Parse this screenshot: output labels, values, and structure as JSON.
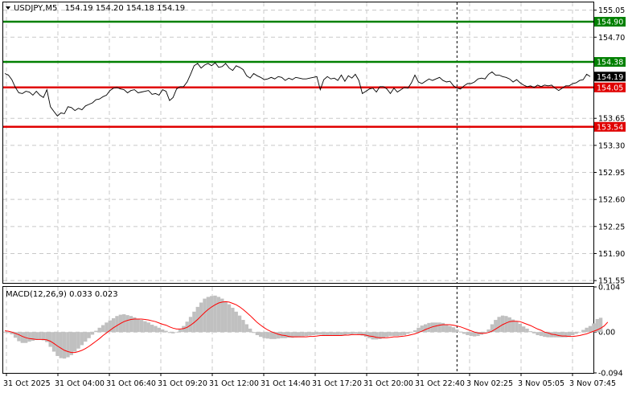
{
  "header": {
    "symbol": "USDJPY,M5",
    "ohlc": "154.19 154.20 154.18 154.19"
  },
  "macd_header": "MACD(12,26,9) 0.033 0.023",
  "colors": {
    "support": "#e00000",
    "resistance": "#008000",
    "price_line": "#000000",
    "histogram": "#c0c0c0",
    "signal": "#ff0000",
    "grid": "#c8c8c8"
  },
  "chart_data": [
    {
      "type": "line",
      "name": "USDJPY,M5",
      "grid": true,
      "ylim": [
        151.52,
        155.15
      ],
      "y_ticks": [
        "155.05",
        "154.70",
        "154.05",
        "153.65",
        "153.30",
        "152.95",
        "152.60",
        "152.25",
        "151.90",
        "151.55"
      ],
      "x_ticks": [
        "31 Oct 2025",
        "31 Oct 04:00",
        "31 Oct 06:40",
        "31 Oct 09:20",
        "31 Oct 12:00",
        "31 Oct 14:40",
        "31 Oct 17:20",
        "31 Oct 20:00",
        "31 Oct 22:40",
        "3 Nov 02:25",
        "3 Nov 05:05",
        "3 Nov 07:45"
      ],
      "levels": [
        {
          "value": 154.9,
          "label": "154.90",
          "kind": "resistance"
        },
        {
          "value": 154.38,
          "label": "154.38",
          "kind": "resistance"
        },
        {
          "value": 154.05,
          "label": "154.05",
          "kind": "support"
        },
        {
          "value": 153.54,
          "label": "153.54",
          "kind": "support"
        }
      ],
      "current": {
        "value": 154.19,
        "label": "154.19"
      },
      "vline_index": 129,
      "values": [
        154.23,
        154.21,
        154.15,
        154.05,
        153.98,
        153.97,
        154.0,
        153.99,
        153.95,
        154.0,
        153.95,
        153.92,
        154.02,
        153.8,
        153.74,
        153.68,
        153.72,
        153.71,
        153.8,
        153.79,
        153.75,
        153.78,
        153.76,
        153.81,
        153.83,
        153.85,
        153.89,
        153.9,
        153.93,
        153.95,
        154.01,
        154.04,
        154.05,
        154.03,
        154.02,
        153.98,
        154.01,
        154.02,
        153.98,
        153.99,
        154.0,
        154.01,
        153.96,
        153.97,
        153.95,
        154.02,
        154.0,
        153.88,
        153.92,
        154.03,
        154.06,
        154.06,
        154.12,
        154.22,
        154.33,
        154.36,
        154.3,
        154.34,
        154.36,
        154.33,
        154.37,
        154.31,
        154.32,
        154.36,
        154.3,
        154.27,
        154.33,
        154.31,
        154.28,
        154.2,
        154.17,
        154.23,
        154.2,
        154.18,
        154.15,
        154.16,
        154.18,
        154.16,
        154.19,
        154.18,
        154.14,
        154.17,
        154.15,
        154.18,
        154.17,
        154.16,
        154.16,
        154.17,
        154.18,
        154.19,
        154.02,
        154.15,
        154.19,
        154.16,
        154.17,
        154.14,
        154.21,
        154.13,
        154.2,
        154.17,
        154.22,
        154.14,
        153.97,
        154.0,
        154.03,
        154.04,
        153.99,
        154.06,
        154.06,
        154.03,
        153.97,
        154.04,
        153.99,
        154.02,
        154.05,
        154.04,
        154.11,
        154.21,
        154.12,
        154.1,
        154.13,
        154.16,
        154.14,
        154.16,
        154.18,
        154.14,
        154.12,
        154.13,
        154.07,
        154.04,
        154.03,
        154.07,
        154.1,
        154.1,
        154.12,
        154.16,
        154.17,
        154.16,
        154.22,
        154.25,
        154.21,
        154.21,
        154.19,
        154.18,
        154.16,
        154.12,
        154.15,
        154.11,
        154.08,
        154.06,
        154.07,
        154.05,
        154.08,
        154.06,
        154.08,
        154.07,
        154.08,
        154.04,
        154.01,
        154.04,
        154.07,
        154.07,
        154.1,
        154.11,
        154.14,
        154.15,
        154.22,
        154.19
      ]
    },
    {
      "type": "bar",
      "name": "MACD(12,26,9)",
      "ylim": [
        -0.094,
        0.104
      ],
      "y_ticks": [
        "0.104",
        "0.00",
        "-0.094"
      ],
      "macd_main": [
        0.0,
        -0.002,
        -0.005,
        -0.013,
        -0.021,
        -0.025,
        -0.025,
        -0.022,
        -0.02,
        -0.018,
        -0.017,
        -0.019,
        -0.023,
        -0.034,
        -0.045,
        -0.055,
        -0.06,
        -0.061,
        -0.058,
        -0.053,
        -0.045,
        -0.038,
        -0.03,
        -0.022,
        -0.014,
        -0.006,
        0.003,
        0.01,
        0.016,
        0.022,
        0.027,
        0.032,
        0.037,
        0.04,
        0.041,
        0.039,
        0.037,
        0.034,
        0.031,
        0.028,
        0.025,
        0.022,
        0.017,
        0.014,
        0.01,
        0.006,
        0.003,
        -0.002,
        -0.003,
        0.0,
        0.006,
        0.014,
        0.024,
        0.035,
        0.047,
        0.058,
        0.068,
        0.077,
        0.081,
        0.083,
        0.084,
        0.081,
        0.077,
        0.071,
        0.064,
        0.056,
        0.047,
        0.038,
        0.028,
        0.018,
        0.008,
        -0.002,
        -0.007,
        -0.011,
        -0.014,
        -0.015,
        -0.016,
        -0.016,
        -0.015,
        -0.014,
        -0.014,
        -0.013,
        -0.013,
        -0.012,
        -0.011,
        -0.01,
        -0.009,
        -0.008,
        -0.007,
        -0.006,
        -0.006,
        -0.008,
        -0.008,
        -0.008,
        -0.008,
        -0.008,
        -0.007,
        -0.007,
        -0.005,
        -0.005,
        -0.004,
        -0.005,
        -0.008,
        -0.011,
        -0.014,
        -0.017,
        -0.017,
        -0.016,
        -0.014,
        -0.011,
        -0.009,
        -0.009,
        -0.009,
        -0.008,
        -0.007,
        -0.004,
        0.0,
        0.004,
        0.01,
        0.015,
        0.018,
        0.021,
        0.022,
        0.022,
        0.022,
        0.021,
        0.018,
        0.014,
        0.011,
        0.006,
        0.001,
        -0.004,
        -0.007,
        -0.009,
        -0.01,
        -0.009,
        -0.006,
        -0.002,
        0.006,
        0.018,
        0.028,
        0.035,
        0.038,
        0.037,
        0.034,
        0.029,
        0.025,
        0.019,
        0.013,
        0.008,
        0.002,
        -0.003,
        -0.007,
        -0.009,
        -0.011,
        -0.012,
        -0.012,
        -0.012,
        -0.012,
        -0.012,
        -0.012,
        -0.01,
        -0.007,
        -0.004,
        0.0,
        0.005,
        0.01,
        0.014,
        0.02,
        0.03,
        0.033
      ],
      "signal": [
        0.003,
        0.002,
        0.0,
        -0.003,
        -0.006,
        -0.01,
        -0.013,
        -0.015,
        -0.016,
        -0.017,
        -0.017,
        -0.017,
        -0.018,
        -0.021,
        -0.026,
        -0.032,
        -0.037,
        -0.042,
        -0.045,
        -0.047,
        -0.047,
        -0.045,
        -0.042,
        -0.038,
        -0.033,
        -0.027,
        -0.021,
        -0.015,
        -0.008,
        -0.002,
        0.004,
        0.01,
        0.015,
        0.02,
        0.024,
        0.027,
        0.029,
        0.03,
        0.03,
        0.03,
        0.029,
        0.028,
        0.026,
        0.024,
        0.021,
        0.018,
        0.016,
        0.012,
        0.009,
        0.007,
        0.007,
        0.008,
        0.011,
        0.016,
        0.022,
        0.029,
        0.037,
        0.045,
        0.052,
        0.058,
        0.063,
        0.067,
        0.069,
        0.07,
        0.069,
        0.066,
        0.063,
        0.058,
        0.052,
        0.045,
        0.038,
        0.03,
        0.022,
        0.016,
        0.01,
        0.005,
        0.001,
        -0.002,
        -0.005,
        -0.007,
        -0.008,
        -0.01,
        -0.011,
        -0.011,
        -0.011,
        -0.011,
        -0.011,
        -0.01,
        -0.01,
        -0.009,
        -0.008,
        -0.008,
        -0.008,
        -0.008,
        -0.008,
        -0.008,
        -0.008,
        -0.007,
        -0.007,
        -0.006,
        -0.006,
        -0.006,
        -0.006,
        -0.007,
        -0.009,
        -0.01,
        -0.012,
        -0.013,
        -0.013,
        -0.013,
        -0.012,
        -0.011,
        -0.011,
        -0.01,
        -0.009,
        -0.008,
        -0.006,
        -0.004,
        -0.001,
        0.002,
        0.006,
        0.009,
        0.012,
        0.014,
        0.016,
        0.017,
        0.017,
        0.017,
        0.016,
        0.014,
        0.012,
        0.009,
        0.006,
        0.003,
        0.0,
        -0.002,
        -0.003,
        -0.003,
        -0.001,
        0.002,
        0.007,
        0.012,
        0.017,
        0.021,
        0.024,
        0.025,
        0.025,
        0.024,
        0.021,
        0.018,
        0.015,
        0.011,
        0.007,
        0.004,
        0.0,
        -0.002,
        -0.005,
        -0.006,
        -0.008,
        -0.009,
        -0.009,
        -0.01,
        -0.01,
        -0.009,
        -0.008,
        -0.006,
        -0.004,
        -0.001,
        0.002,
        0.005,
        0.009,
        0.014,
        0.023
      ]
    }
  ]
}
